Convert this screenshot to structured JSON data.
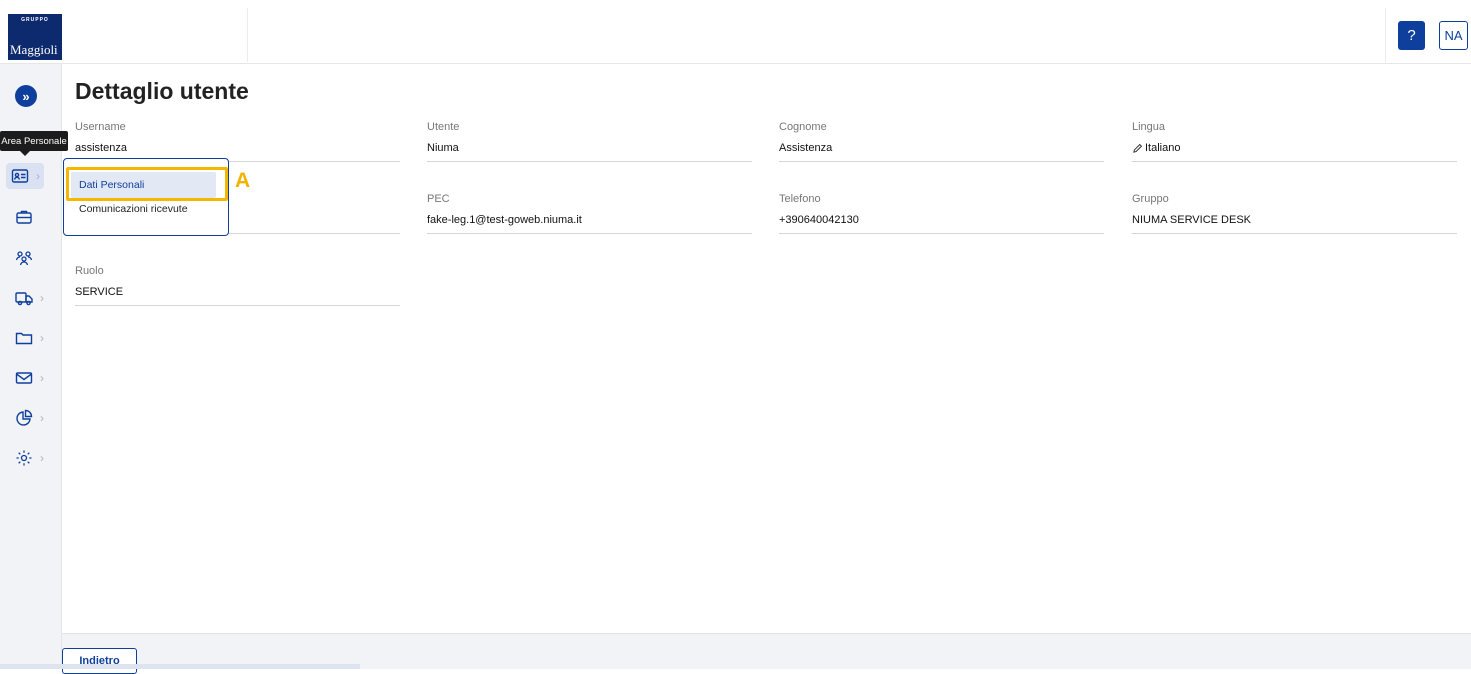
{
  "header": {
    "logo_small": "GRUPPO",
    "logo_brand": "Maggioli",
    "help_label": "?",
    "user_initials": "NA"
  },
  "sidebar": {
    "tooltip": "Area Personale",
    "items": [
      {
        "icon": "id-card-icon"
      },
      {
        "icon": "briefcase-icon"
      },
      {
        "icon": "users-icon"
      },
      {
        "icon": "truck-icon"
      },
      {
        "icon": "folder-icon"
      },
      {
        "icon": "mail-icon"
      },
      {
        "icon": "pie-chart-icon"
      },
      {
        "icon": "gear-icon"
      }
    ]
  },
  "page": {
    "title": "Dettaglio utente"
  },
  "fields": {
    "username": {
      "label": "Username",
      "value": "assistenza"
    },
    "utente": {
      "label": "Utente",
      "value": "Niuma"
    },
    "cognome": {
      "label": "Cognome",
      "value": "Assistenza"
    },
    "lingua": {
      "label": "Lingua",
      "value": "Italiano"
    },
    "pec": {
      "label": "PEC",
      "value": "fake-leg.1@test-goweb.niuma.it"
    },
    "telefono": {
      "label": "Telefono",
      "value": "+390640042130"
    },
    "gruppo": {
      "label": "Gruppo",
      "value": "NIUMA SERVICE DESK"
    },
    "ruolo": {
      "label": "Ruolo",
      "value": "SERVICE"
    }
  },
  "popup_menu": {
    "items": [
      "Dati Personali",
      "Comunicazioni ricevute"
    ]
  },
  "annotation": {
    "letter": "A",
    "color": "#f5b800"
  },
  "footer": {
    "back_label": "Indietro"
  },
  "colors": {
    "primary": "#0e3f9c",
    "sidebar_bg": "#f2f3f6"
  }
}
